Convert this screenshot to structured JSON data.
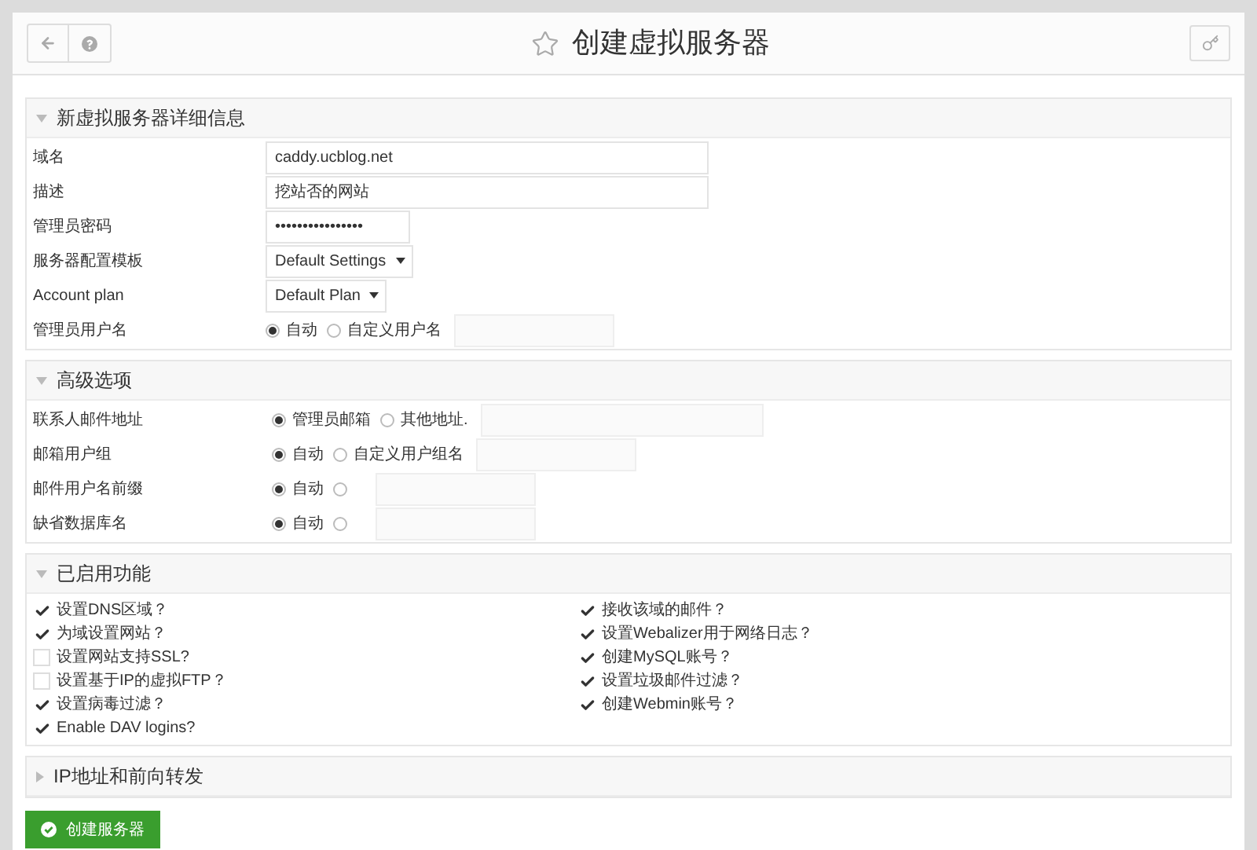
{
  "header": {
    "title": "创建虚拟服务器"
  },
  "sections": [
    {
      "title": "新虚拟服务器详细信息",
      "expanded": true,
      "kind": "form",
      "rows": [
        {
          "label": "域名",
          "kind": "text",
          "value": "caddy.ucblog.net"
        },
        {
          "label": "描述",
          "kind": "text",
          "value": "挖站否的网站"
        },
        {
          "label": "管理员密码",
          "kind": "password",
          "value": "••••••••••••••••"
        },
        {
          "label": "服务器配置模板",
          "kind": "select",
          "value": "Default Settings"
        },
        {
          "label": "Account plan",
          "kind": "select",
          "value": "Default Plan"
        },
        {
          "label": "管理员用户名",
          "kind": "radio",
          "options": [
            {
              "label": "自动",
              "selected": true
            },
            {
              "label": "自定义用户名",
              "selected": false
            }
          ]
        }
      ]
    },
    {
      "title": "高级选项",
      "expanded": true,
      "kind": "form",
      "rows": [
        {
          "label": "联系人邮件地址",
          "kind": "radio",
          "options": [
            {
              "label": "管理员邮箱",
              "selected": true
            },
            {
              "label": "其他地址.",
              "selected": false
            }
          ]
        },
        {
          "label": "邮箱用户组",
          "kind": "radio",
          "options": [
            {
              "label": "自动",
              "selected": true
            },
            {
              "label": "自定义用户组名",
              "selected": false
            }
          ]
        },
        {
          "label": "邮件用户名前缀",
          "kind": "radio",
          "options": [
            {
              "label": "自动",
              "selected": true
            },
            {
              "selected": false
            }
          ]
        },
        {
          "label": "缺省数据库名",
          "kind": "radio",
          "options": [
            {
              "label": "自动",
              "selected": true
            },
            {
              "selected": false
            }
          ]
        }
      ]
    },
    {
      "title": "已启用功能",
      "expanded": true,
      "kind": "checks",
      "columns": [
        [
          {
            "label": "设置DNS区域？",
            "checked": true
          },
          {
            "label": "为域设置网站？",
            "checked": true
          },
          {
            "label": "设置网站支持SSL?",
            "checked": false
          },
          {
            "label": "设置基于IP的虚拟FTP？",
            "checked": false
          },
          {
            "label": "设置病毒过滤？",
            "checked": true
          },
          {
            "label": "Enable DAV logins?",
            "checked": true
          }
        ],
        [
          {
            "label": "接收该域的邮件？",
            "checked": true
          },
          {
            "label": "设置Webalizer用于网络日志？",
            "checked": true
          },
          {
            "label": "创建MySQL账号？",
            "checked": true
          },
          {
            "label": "设置垃圾邮件过滤？",
            "checked": true
          },
          {
            "label": "创建Webmin账号？",
            "checked": true
          }
        ]
      ]
    },
    {
      "title": "IP地址和前向转发",
      "expanded": false
    }
  ],
  "submit": {
    "label": "创建服务器"
  }
}
